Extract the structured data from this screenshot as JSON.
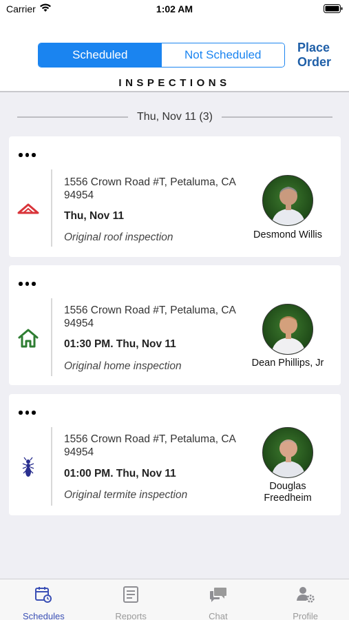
{
  "status_bar": {
    "carrier": "Carrier",
    "time": "1:02 AM"
  },
  "header": {
    "segments": [
      {
        "label": "Scheduled",
        "active": true
      },
      {
        "label": "Not Scheduled",
        "active": false
      }
    ],
    "place_order_label": "Place Order",
    "title": "INSPECTIONS"
  },
  "date_group": {
    "label": "Thu, Nov 11 (3)"
  },
  "inspections": [
    {
      "type_icon": "roof-icon",
      "address": "1556 Crown Road #T, Petaluma, CA 94954",
      "datetime": "Thu, Nov 11",
      "description": "Original roof inspection",
      "inspector": "Desmond Willis"
    },
    {
      "type_icon": "home-icon",
      "address": "1556 Crown Road #T, Petaluma, CA 94954",
      "datetime": "01:30 PM. Thu, Nov 11",
      "description": "Original home inspection",
      "inspector": "Dean Phillips, Jr"
    },
    {
      "type_icon": "termite-icon",
      "address": "1556 Crown Road #T, Petaluma, CA 94954",
      "datetime": "01:00 PM. Thu, Nov 11",
      "description": "Original termite inspection",
      "inspector": "Douglas Freedheim"
    }
  ],
  "tab_bar": {
    "tabs": [
      {
        "label": "Schedules",
        "icon": "calendar-icon",
        "active": true
      },
      {
        "label": "Reports",
        "icon": "report-icon",
        "active": false
      },
      {
        "label": "Chat",
        "icon": "chat-icon",
        "active": false
      },
      {
        "label": "Profile",
        "icon": "profile-settings-icon",
        "active": false
      }
    ]
  },
  "colors": {
    "accent": "#1a84f0",
    "place_order": "#1f5fa8",
    "roof_icon": "#d9343a",
    "home_icon": "#2e7d32",
    "termite_icon": "#2a2f8f",
    "tab_active": "#3a4fb5"
  }
}
